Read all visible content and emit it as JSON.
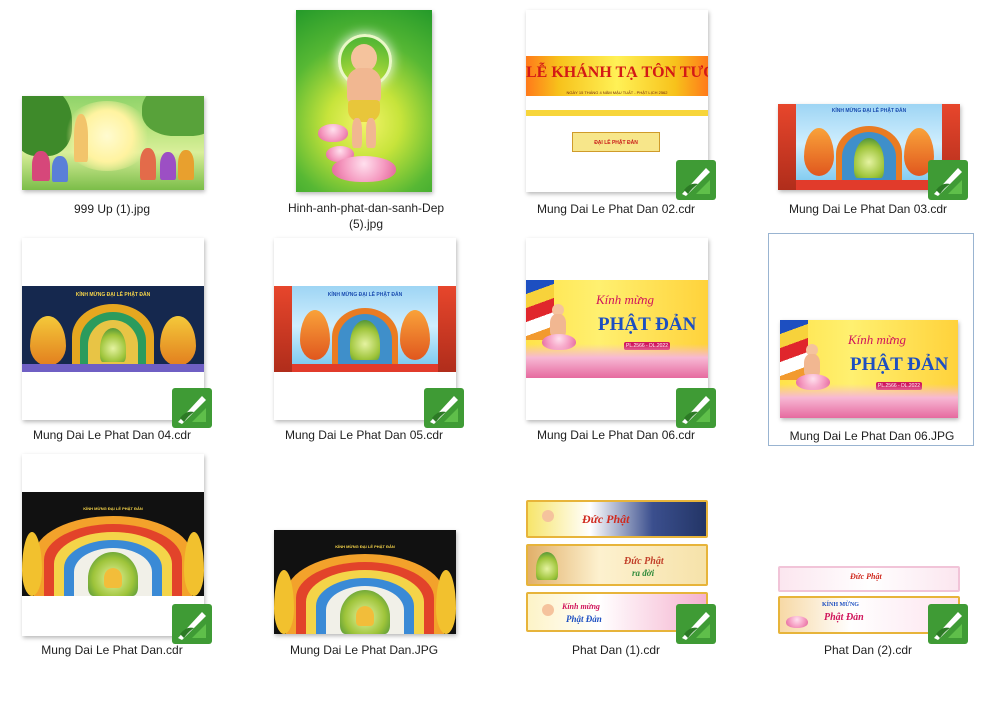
{
  "files": [
    {
      "name": "999 Up (1).jpg",
      "type": "jpg"
    },
    {
      "name": "Hinh-anh-phat-dan-sanh-Dep (5).jpg",
      "name_line1": "Hinh-anh-phat-dan-sanh-Dep",
      "name_line2": "(5).jpg",
      "type": "jpg"
    },
    {
      "name": "Mung Dai Le Phat Dan 02.cdr",
      "type": "cdr"
    },
    {
      "name": "Mung Dai Le Phat Dan 03.cdr",
      "type": "cdr"
    },
    {
      "name": "Mung Dai Le Phat Dan 04.cdr",
      "type": "cdr"
    },
    {
      "name": "Mung Dai Le Phat Dan 05.cdr",
      "type": "cdr"
    },
    {
      "name": "Mung Dai Le Phat Dan 06.cdr",
      "type": "cdr"
    },
    {
      "name": "Mung Dai Le Phat Dan 06.JPG",
      "type": "jpg",
      "selected": true
    },
    {
      "name": "Mung Dai Le Phat Dan.cdr",
      "type": "cdr"
    },
    {
      "name": "Mung Dai Le Phat Dan.JPG",
      "type": "jpg"
    },
    {
      "name": "Phat Dan (1).cdr",
      "type": "cdr"
    },
    {
      "name": "Phat Dan (2).cdr",
      "type": "cdr"
    }
  ],
  "artwork_text": {
    "le_khanh_title": "LỄ KHÁNH TẠ TÔN TƯỢNG",
    "kinh_mung": "Kính mừng",
    "phat_dan": "PHẬT ĐẢN",
    "dai_le_phat_dan": "ĐẠI LỄ PHẬT ĐẢN",
    "duc_phat": "Đức Phật",
    "ra_doi": "ra đời",
    "phat_dan_lower": "Phật Đản",
    "kinh_mung_caps": "KÍNH MỪNG"
  },
  "colors": {
    "selection_border": "#99b4d1",
    "coreldraw_green": "#3f9b35",
    "label_text": "#1e1e1e"
  },
  "icons": {
    "cdr_badge": "coreldraw-file-icon"
  }
}
